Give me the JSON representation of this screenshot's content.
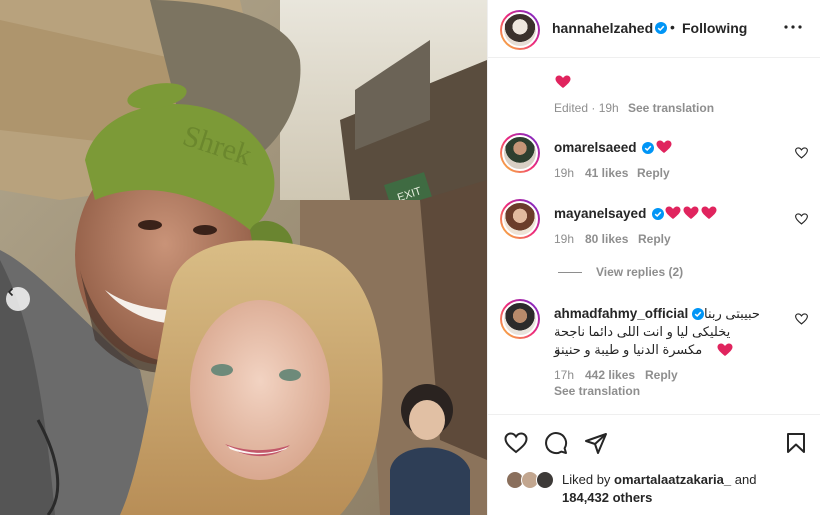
{
  "post": {
    "author": "hannahelzahed",
    "follow_status": "Following",
    "separator": "•",
    "caption_emoji": "❤️",
    "caption_time": "Edited · 19h",
    "see_translation": "See translation"
  },
  "comments": [
    {
      "user": "omarelsaeed",
      "text": "❤️",
      "time": "19h",
      "likes": "41 likes",
      "reply": "Reply"
    },
    {
      "user": "mayanelsayed",
      "text": "❤️❤️❤️",
      "time": "19h",
      "likes": "80 likes",
      "reply": "Reply",
      "view_replies": "View replies (2)"
    },
    {
      "user": "ahmadfahmy_official",
      "text_line1": "حبيبتى ربنا",
      "text_line2": "يخليكى ليا و انت اللى دائما ناجحة و",
      "text_line3": "مكسرة الدنيا و طيبة و حنينة",
      "text_emoji": "❤️",
      "time": "17h",
      "likes": "442 likes",
      "reply": "Reply",
      "see_translation": "See translation"
    }
  ],
  "likes": {
    "prefix": "Liked by",
    "user": "omartalaatzakaria_",
    "and": "and",
    "count": "184,432 others"
  },
  "icons": [
    "verified-badge",
    "more-icon",
    "heart-icon",
    "comment-icon",
    "share-icon",
    "save-icon",
    "chevron-left-icon"
  ],
  "colors": {
    "heart_red": "#ed4956",
    "verified_blue": "#0095f6",
    "gray_text": "#8e8e8e"
  }
}
